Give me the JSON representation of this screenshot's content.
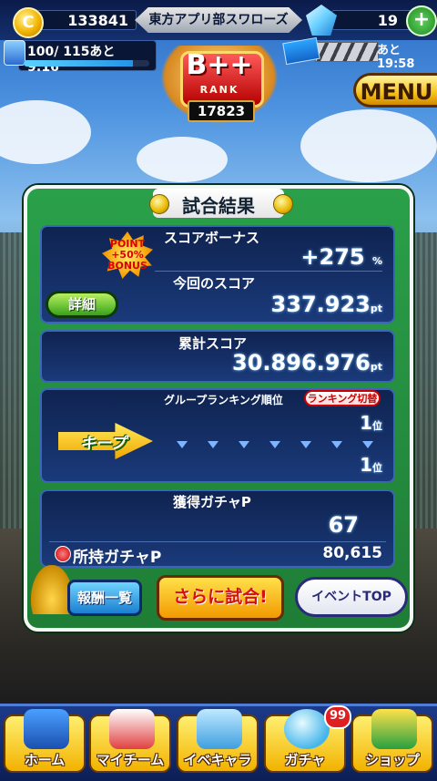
{
  "topbar": {
    "coins": "133841",
    "team_name": "東方アプリ部スワローズ",
    "gems": "19",
    "gem_plus": "+"
  },
  "stamina": {
    "text": "100/ 115あと　9:16",
    "fill_ratio": 0.87
  },
  "ticket": {
    "timer": "あと 19:58"
  },
  "rank": {
    "grade": "B++",
    "word": "RANK",
    "score": "17823"
  },
  "menu": {
    "label": "MENU"
  },
  "result": {
    "title": "試合結果",
    "score_bonus_label": "スコアボーナス",
    "score_bonus_value": "+275",
    "score_bonus_unit": "%",
    "bonus_badge": "POINT +50% BONUS",
    "this_score_label": "今回のスコア",
    "this_score_value": "337.923",
    "this_score_unit": "pt",
    "detail_button": "詳細",
    "total_score_label": "累計スコア",
    "total_score_value": "30.896.976",
    "total_score_unit": "pt",
    "group_rank_label": "グループランキング順位",
    "ranking_switch": "ランキング切替",
    "rank_before": "1",
    "rank_after": "1",
    "rank_unit": "位",
    "keep_label": "キープ",
    "gacha_earned_label": "獲得ガチャP",
    "gacha_earned_value": "67",
    "gacha_owned_label": "所持ガチャP",
    "gacha_owned_value": "80,615"
  },
  "actions": {
    "rewards_list": "報酬一覧",
    "play_again": "さらに試合!",
    "event_top": "イベントTOP"
  },
  "nav": {
    "items": [
      {
        "label": "ホーム"
      },
      {
        "label": "マイチーム"
      },
      {
        "label": "イベキャラ"
      },
      {
        "label": "ガチャ"
      },
      {
        "label": "ショップ"
      }
    ],
    "gacha_badge": "99"
  }
}
